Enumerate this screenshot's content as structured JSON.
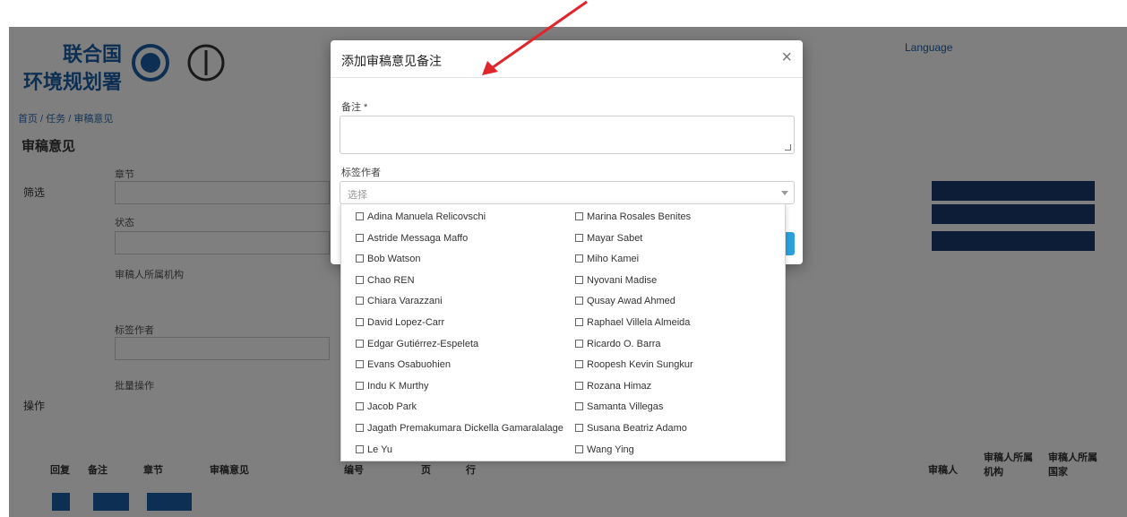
{
  "app": {
    "logo_line1": "联合国",
    "logo_line2": "环境规划署",
    "topnav": [
      "",
      "",
      "Language",
      ""
    ],
    "breadcrumb": "首页 / 任务 / 审稿意见",
    "page_title": "审稿意见",
    "side_labels": [
      "筛选",
      "操作"
    ],
    "fields": [
      "章节",
      "状态",
      "审稿人所属机构",
      "标签作者",
      "批量操作"
    ],
    "side_buttons": [
      "",
      "",
      ""
    ],
    "table_headers": [
      "回复",
      "备注",
      "章节",
      "审稿意见",
      "编号",
      "页",
      "行",
      "审稿人",
      "审稿人所属机构",
      "审稿人所属国家"
    ],
    "row_buttons": [
      "",
      "",
      ""
    ]
  },
  "modal": {
    "title": "添加审稿意见备注",
    "close": "×",
    "note_label": "备注 *",
    "authors_label": "标签作者",
    "select_placeholder": "选择"
  },
  "options_left": [
    "Adina Manuela Relicovschi",
    "Astride Messaga Maffo",
    "Bob Watson",
    "Chao REN",
    "Chiara Varazzani",
    "David Lopez-Carr",
    "Edgar Gutiérrez-Espeleta",
    "Evans Osabuohien",
    "Indu K Murthy",
    "Jacob Park",
    "Jagath Premakumara Dickella Gamaralalage",
    "Le Yu"
  ],
  "options_right": [
    "Marina Rosales Benites",
    "Mayar Sabet",
    "Miho Kamei",
    "Nyovani Madise",
    "Qusay Awad Ahmed",
    "Raphael Villela Almeida",
    "Ricardo O. Barra",
    "Roopesh Kevin Sungkur",
    "Rozana Himaz",
    "Samanta Villegas",
    "Susana Beatriz Adamo",
    "Wang Ying"
  ],
  "colors": {
    "accent": "#1b5fa6",
    "arrow": "#e0262b",
    "overlay": "rgba(0,0,0,0.5)"
  }
}
